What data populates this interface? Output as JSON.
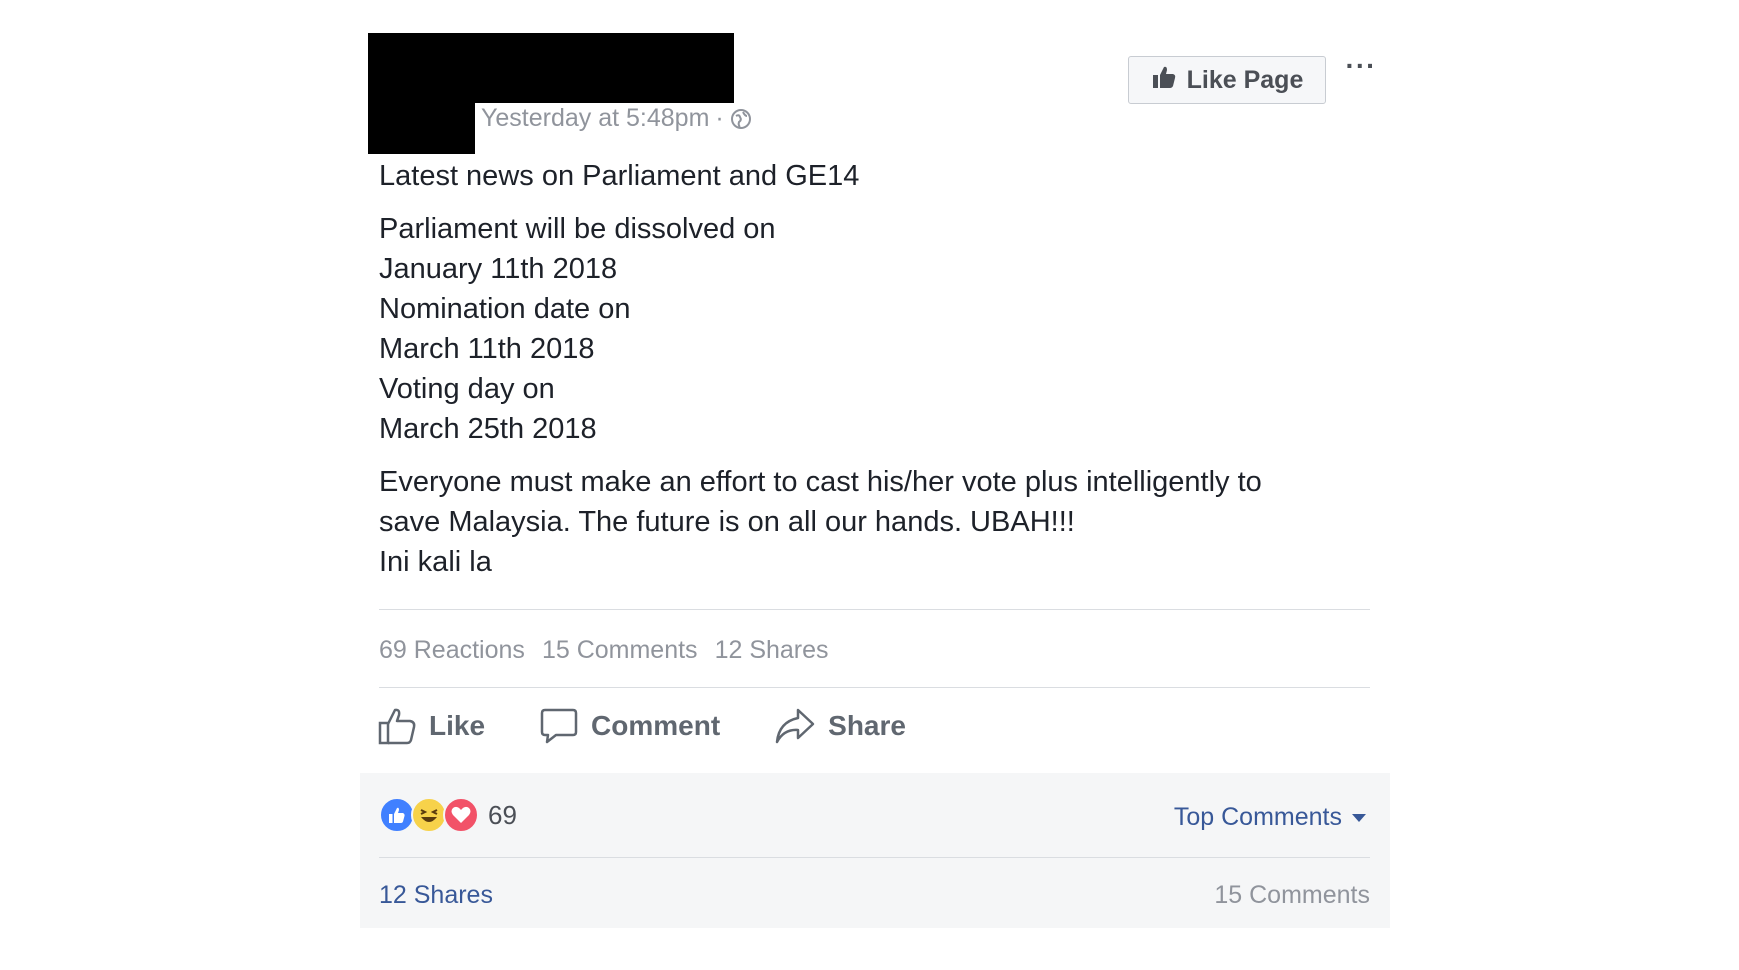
{
  "post": {
    "timestamp": "Yesterday at 5:48pm",
    "separator": "·",
    "privacy_icon": "globe-icon",
    "like_page_label": "Like Page",
    "more_label": "···",
    "paragraphs": [
      "Latest news on Parliament and GE14",
      "Parliament will be dissolved on",
      "January 11th 2018",
      "Nomination date on",
      "March 11th 2018",
      "Voting day on",
      "March 25th 2018",
      "Everyone must make an effort to cast his/her vote plus intelligently to",
      "save Malaysia. The future is on all our hands. UBAH!!!",
      "Ini kali la"
    ]
  },
  "stats": {
    "reactions": "69 Reactions",
    "comments": "15 Comments",
    "shares": "12 Shares"
  },
  "actions": {
    "like": "Like",
    "comment": "Comment",
    "share": "Share"
  },
  "comments_panel": {
    "reaction_count": "69",
    "reaction_icons": [
      "like-reaction-icon",
      "haha-reaction-icon",
      "love-reaction-icon"
    ],
    "top_comments_label": "Top Comments",
    "shares_link": "12 Shares",
    "comments_count": "15 Comments"
  },
  "colors": {
    "link_blue": "#385898",
    "meta_gray": "#90949c",
    "like_reaction": "#4080ff",
    "haha_reaction": "#f7d24a",
    "love_reaction": "#f25268",
    "redaction": "#000000"
  }
}
